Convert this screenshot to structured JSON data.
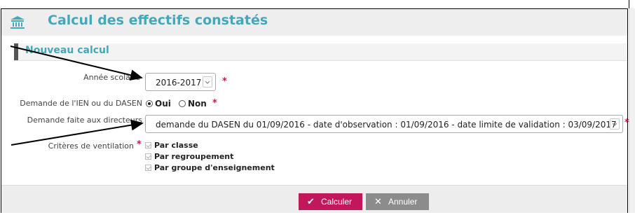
{
  "header": {
    "title": "Calcul des effectifs constatés",
    "icon": "bank-icon"
  },
  "section": {
    "title": "Nouveau calcul"
  },
  "form": {
    "annee": {
      "label": "Année scolaire",
      "value": "2016-2017"
    },
    "demande_ien": {
      "label": "Demande de l'IEN ou du DASEN",
      "opt_oui": "Oui",
      "opt_non": "Non",
      "selected": "Oui"
    },
    "demande_dir": {
      "label": "Demande faite aux directeurs",
      "value": "demande du DASEN du 01/09/2016 - date d'observation : 01/09/2016 - date limite de validation : 03/09/2017"
    },
    "criteres": {
      "label": "Critères de ventilation",
      "options": [
        "Par classe",
        "Par regroupement",
        "Par groupe d'enseignement"
      ]
    },
    "required_mark": "*"
  },
  "actions": {
    "calculer": "Calculer",
    "annuler": "Annuler"
  },
  "colors": {
    "accent": "#44a8b9",
    "primary_button": "#c2185b",
    "secondary_button": "#8c8c8c"
  }
}
